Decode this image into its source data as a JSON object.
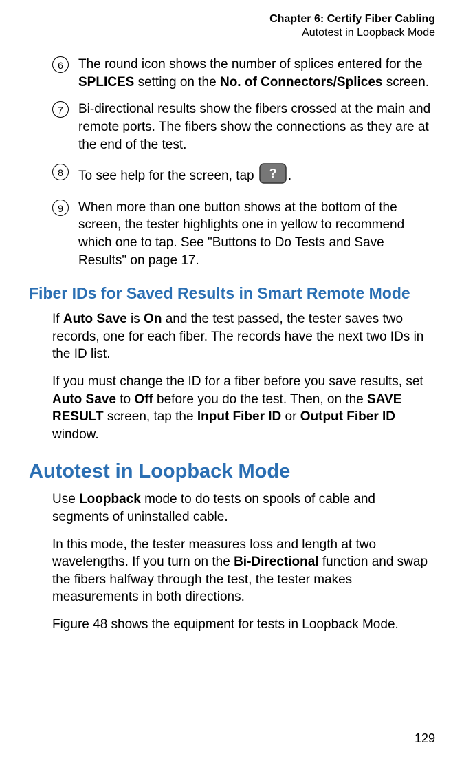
{
  "header": {
    "chapter": "Chapter 6: Certify Fiber Cabling",
    "section": "Autotest in Loopback Mode"
  },
  "list": {
    "item6_num": "6",
    "item6_t1": "The round icon shows the number of splices entered for the ",
    "item6_b1": "SPLICES",
    "item6_t2": " setting on the ",
    "item6_b2": "No. of Connectors/Splices",
    "item6_t3": " screen.",
    "item7_num": "7",
    "item7_t1": "Bi-directional results show the fibers crossed at the main and remote ports. The fibers show the connections as they are at the end of the test.",
    "item8_num": "8",
    "item8_t1": "To see help for the screen, tap ",
    "item8_t2": ".",
    "item9_num": "9",
    "item9_t1": "When more than one button shows at the bottom of the screen, the tester highlights one in yellow to recommend which one to tap. See \"Buttons to Do Tests and Save Results\" on page 17."
  },
  "h2a": "Fiber IDs for Saved Results in Smart Remote Mode",
  "p1_t1": "If ",
  "p1_b1": "Auto Save",
  "p1_t2": " is ",
  "p1_b2": "On",
  "p1_t3": " and the test passed, the tester saves two records, one for each fiber. The records have the next two IDs in the ID list.",
  "p2_t1": "If you must change the ID for a fiber before you save results, set ",
  "p2_b1": "Auto Save",
  "p2_t2": " to ",
  "p2_b2": "Off",
  "p2_t3": " before you do the test. Then, on the ",
  "p2_b3": "SAVE RESULT",
  "p2_t4": " screen, tap the ",
  "p2_b4": "Input Fiber ID",
  "p2_t5": " or ",
  "p2_b5": "Output Fiber ID",
  "p2_t6": " window.",
  "h1a": "Autotest in Loopback Mode",
  "p3_t1": "Use ",
  "p3_b1": "Loopback",
  "p3_t2": " mode to do tests on spools of cable and segments of uninstalled cable.",
  "p4_t1": "In this mode, the tester measures loss and length at two wavelengths. If you turn on the ",
  "p4_b1": "Bi-Directional",
  "p4_t2": " function and swap the fibers halfway through the test, the tester makes measurements in both directions.",
  "p5_t1": "Figure 48 shows the equipment for tests in Loopback Mode.",
  "page_number": "129"
}
